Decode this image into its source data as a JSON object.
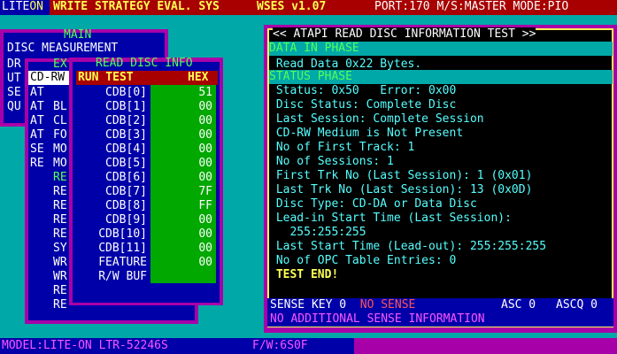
{
  "header": {
    "logo_prefix": "LITE",
    "logo_suffix": "ON",
    "title": "WRITE STRATEGY EVAL. SYS",
    "version": "WSES v1.07",
    "status": "PORT:170 M/S:MASTER MODE:PIO"
  },
  "main_menu": {
    "title": "MAIN",
    "items": [
      "DISC MEASUREMENT",
      "DR",
      "UT",
      "SE",
      "QU"
    ]
  },
  "ex_menu": {
    "title": "EX",
    "items": [
      "CD-RW",
      "AT",
      "AT",
      "AT",
      "AT",
      "SE",
      "RE"
    ],
    "sub_items": [
      "BL",
      "CL",
      "FO",
      "MO",
      "MO",
      "RE",
      "RE",
      "RE",
      "RE",
      "RE",
      "SY",
      "WR",
      "WR",
      "RE",
      "RE"
    ]
  },
  "read_disc_info": {
    "title": "READ DISC INFO",
    "header_left": "RUN TEST",
    "header_right": "HEX",
    "rows": [
      {
        "label": "CDB[0]",
        "value": "51"
      },
      {
        "label": "CDB[1]",
        "value": "00"
      },
      {
        "label": "CDB[2]",
        "value": "00"
      },
      {
        "label": "CDB[3]",
        "value": "00"
      },
      {
        "label": "CDB[4]",
        "value": "00"
      },
      {
        "label": "CDB[5]",
        "value": "00"
      },
      {
        "label": "CDB[6]",
        "value": "00"
      },
      {
        "label": "CDB[7]",
        "value": "7F"
      },
      {
        "label": "CDB[8]",
        "value": "FF"
      },
      {
        "label": "CDB[9]",
        "value": "00"
      },
      {
        "label": "CDB[10]",
        "value": "00"
      },
      {
        "label": "CDB[11]",
        "value": "00"
      },
      {
        "label": "FEATURE",
        "value": "00"
      },
      {
        "label": "R/W BUF",
        "value": ""
      }
    ]
  },
  "test_panel": {
    "title": "<< ATAPI READ DISC INFORMATION TEST >>",
    "data_in_head": "DATA IN PHASE",
    "data_in_line": " Read Data 0x22 Bytes.",
    "status_head": "STATUS PHASE",
    "lines": [
      " Status: 0x50   Error: 0x00",
      " Disc Status: Complete Disc",
      " Last Session: Complete Session",
      " CD-RW Medium is Not Present",
      " No of First Track: 1",
      " No of Sessions: 1",
      " First Trk No (Last Session): 1 (0x01)",
      " Last Trk No (Last Session): 13 (0x0D)",
      " Disc Type: CD-DA or Data Disc",
      " Lead-in Start Time (Last Session):",
      "   255:255:255",
      " Last Start Time (Lead-out): 255:255:255",
      " No of OPC Table Entries: 0"
    ],
    "end": " TEST END!",
    "sense_key_label": "SENSE KEY 0",
    "sense_key_value": "NO SENSE",
    "asc": "ASC 0",
    "ascq": "ASCQ 0",
    "sense_info": "NO ADDITIONAL SENSE INFORMATION"
  },
  "footer": {
    "model": "MODEL:LITE-ON LTR-52246S",
    "firmware": "F/W:6S0F"
  }
}
